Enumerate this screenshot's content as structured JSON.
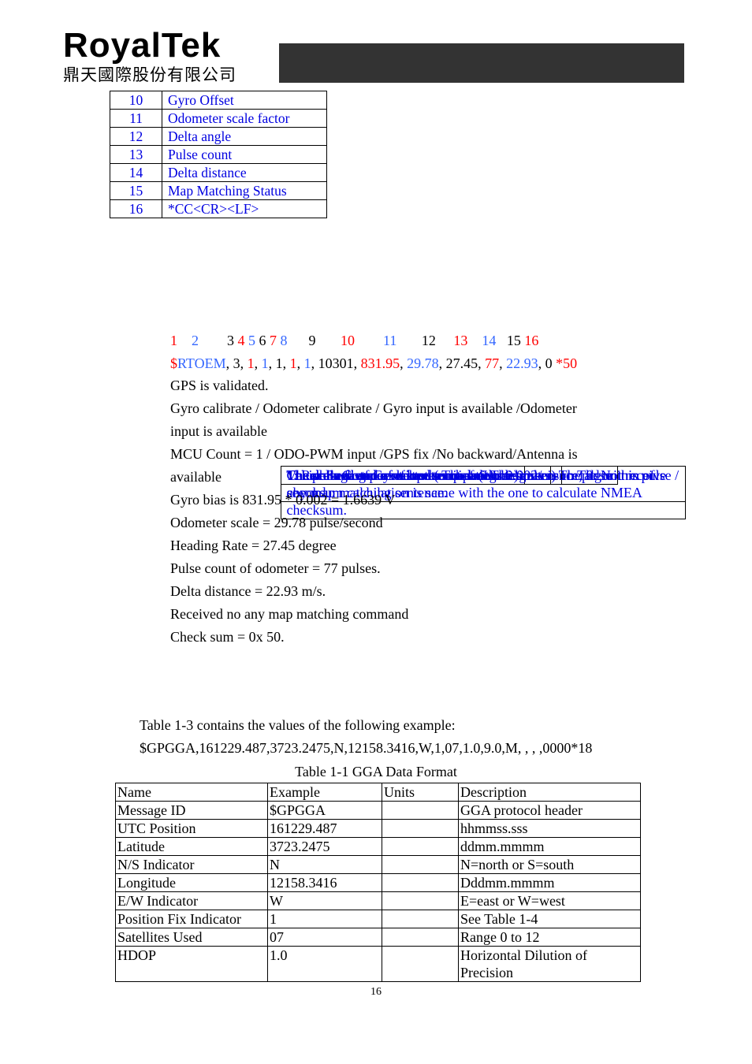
{
  "header": {
    "logo_text": "RoyalTek",
    "logo_subtext": "鼎天國際股份有限公司"
  },
  "field_table": {
    "rows": [
      {
        "num": "10",
        "name": "Gyro Offset",
        "desc": "The voltage of Gyro input. The unit is 0.002v"
      },
      {
        "num": "11",
        "name": "Odometer scale factor",
        "desc": "The scale factor of odometer pulse. The scale is cm/pulse"
      },
      {
        "num": "12",
        "name": "Delta angle",
        "desc": "Vehicle’s Cog per second (unit = degree)"
      },
      {
        "num": "13",
        "name": "Pulse count",
        "desc": "The pulse count of last second of odometer sensor. The unit is pulse / second."
      },
      {
        "num": "14",
        "name": "Delta distance",
        "desc": "The delta distance of last second. (Unit = m / s)"
      },
      {
        "num": "15",
        "name": "Map Matching Status",
        "desc": "1: Received and executed a map matching sentence; 0: Not receive any map matching sentence."
      },
      {
        "num": "16",
        "name": "*CC<CR><LF>",
        "desc": "Check Sum and sentence termination delimiter. The algorithm of checksum calculation is same with the one to calculate NMEA checksum."
      }
    ]
  },
  "example": {
    "index_line": [
      "1",
      "2",
      "3",
      "4",
      "5",
      "6",
      "7",
      "8",
      "9",
      "10",
      "11",
      "12",
      "13",
      "14",
      "15",
      "16"
    ],
    "sentence": {
      "dollar": "$",
      "id": "RTOEM",
      "fields": [
        "3",
        "1",
        "1",
        "1",
        "1",
        "1",
        "10301",
        "831.95",
        "29.78",
        "27.45",
        "77",
        "22.93",
        "0"
      ],
      "checksum": "*50"
    },
    "colors": {
      "red": "#ff0000",
      "blue": "#3366ff",
      "black": "#000000"
    }
  },
  "description_lines": [
    "GPS is validated.",
    "Gyro calibrate / Odometer calibrate / Gyro input is available /Odometer",
    "input is available",
    "MCU Count = 1 / ODO-PWM input /GPS fix /No backward/Antenna is",
    "available",
    "Gyro bias is 831.95 * 0.002 = 1.6639 V",
    "Odometer scale = 29.78 pulse/second",
    "Heading Rate = 27.45 degree",
    "Pulse count of odometer = 77 pulses.",
    "Delta distance = 22.93 m/s.",
    "Received no any map matching command",
    "Check sum = 0x 50."
  ],
  "intro": {
    "line1": "Table 1-3 contains the values of the following example:",
    "line2": "$GPGGA,161229.487,3723.2475,N,12158.3416,W,1,07,1.0,9.0,M, , , ,0000*18"
  },
  "gga_table": {
    "caption": "Table 1-1 GGA Data Format",
    "headers": [
      "Name",
      "Example",
      "Units",
      "Description"
    ],
    "rows": [
      [
        "Message ID",
        "$GPGGA",
        "",
        "GGA protocol header"
      ],
      [
        "UTC Position",
        "161229.487",
        "",
        "hhmmss.sss"
      ],
      [
        "Latitude",
        "3723.2475",
        "",
        "ddmm.mmmm"
      ],
      [
        "N/S Indicator",
        "N",
        "",
        "N=north or S=south"
      ],
      [
        "Longitude",
        "12158.3416",
        "",
        "Dddmm.mmmm"
      ],
      [
        "E/W Indicator",
        "W",
        "",
        "E=east or W=west"
      ],
      [
        "Position Fix Indicator",
        "1",
        "",
        "See Table 1-4"
      ],
      [
        "Satellites Used",
        "07",
        "",
        "Range 0 to 12"
      ],
      [
        "HDOP",
        "1.0",
        "",
        "Horizontal Dilution of Precision"
      ]
    ]
  },
  "page_number": "16"
}
